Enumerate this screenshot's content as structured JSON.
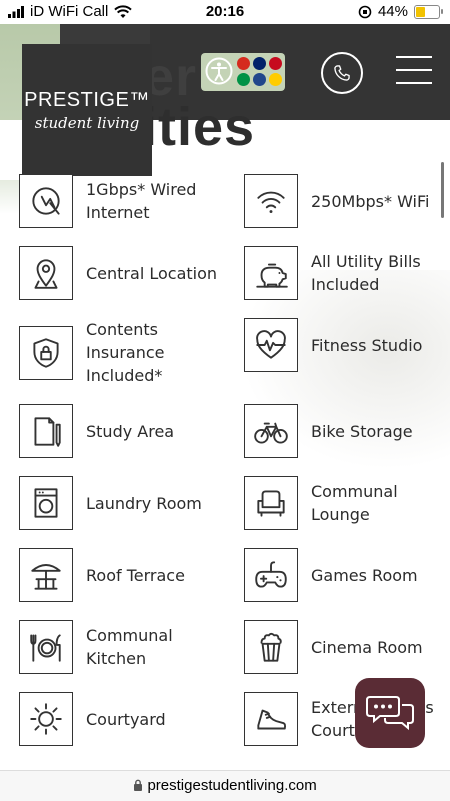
{
  "status_bar": {
    "carrier": "iD WiFi Call",
    "time": "20:16",
    "battery_percent": "44%",
    "battery_level": 0.44
  },
  "header": {
    "brand_name": "PRESTIGE™",
    "brand_tagline": "student living",
    "page_heading_line1": "er",
    "page_heading_line2": "nities",
    "flags": [
      "#d52b1e",
      "#012169",
      "#c60b1e",
      "#009246",
      "#21468b",
      "#ffcc00"
    ]
  },
  "amenities": [
    {
      "label": "1Gbps* Wired Internet",
      "icon": "wired-internet-icon"
    },
    {
      "label": "250Mbps* WiFi",
      "icon": "wifi-icon"
    },
    {
      "label": "Central Location",
      "icon": "location-pin-icon"
    },
    {
      "label": "All Utility Bills Included",
      "icon": "piggy-bank-icon"
    },
    {
      "label": "Contents Insurance Included*",
      "icon": "shield-lock-icon"
    },
    {
      "label": "Fitness Studio",
      "icon": "heartbeat-icon"
    },
    {
      "label": "Study Area",
      "icon": "document-pen-icon"
    },
    {
      "label": "Bike Storage",
      "icon": "bicycle-icon"
    },
    {
      "label": "Laundry Room",
      "icon": "washing-machine-icon"
    },
    {
      "label": "Communal Lounge",
      "icon": "armchair-icon"
    },
    {
      "label": "Roof Terrace",
      "icon": "patio-umbrella-icon"
    },
    {
      "label": "Games Room",
      "icon": "gamepad-icon"
    },
    {
      "label": "Communal Kitchen",
      "icon": "plate-cutlery-icon"
    },
    {
      "label": "Cinema Room",
      "icon": "popcorn-icon"
    },
    {
      "label": "Courtyard",
      "icon": "sun-icon"
    },
    {
      "label": "External Sports Court",
      "icon": "running-shoe-icon"
    }
  ],
  "url": "prestigestudentliving.com",
  "colors": {
    "header_dark": "#3a3a3a",
    "accent_green": "#c4d3b6",
    "chat_button": "#5a2c35"
  }
}
